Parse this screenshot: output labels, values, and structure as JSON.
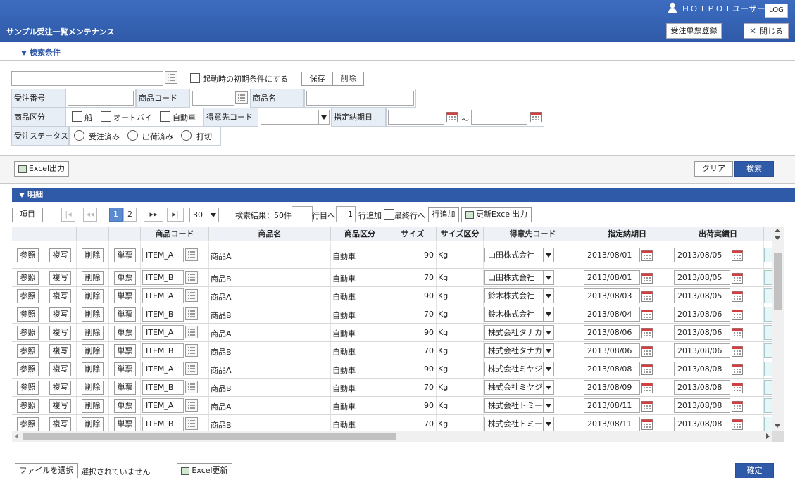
{
  "header": {
    "page_title": "サンプル受注一覧メンテナンス",
    "user_name": "ＨＯＩＰＯＩユーザー",
    "log_label": "LOG",
    "order_register_label": "受注単票登録",
    "close_label": "閉じる"
  },
  "search": {
    "section_label": "検索条件",
    "preset_value": "",
    "init_condition_label": "起動時の初期条件にする",
    "save_label": "保存",
    "delete_label": "削除",
    "order_no_label": "受注番号",
    "product_code_label": "商品コード",
    "product_name_label": "商品名",
    "category_label": "商品区分",
    "category_options": [
      "船",
      "オートバイ",
      "自動車"
    ],
    "customer_code_label": "得意先コード",
    "due_date_label": "指定納期日",
    "tilde": "～",
    "status_label": "受注ステータス",
    "status_options": [
      "受注済み",
      "出荷済み",
      "打切"
    ],
    "excel_out_label": "Excel出力",
    "clear_label": "クリア",
    "search_label": "検索"
  },
  "detail": {
    "section_label": "明細",
    "columns_btn": "項目",
    "pages": [
      "1",
      "2"
    ],
    "page_size": "30",
    "result_text": "検索結果：50件",
    "goto_row_label": "行目へ",
    "add_row_count": "1",
    "add_row_label": "行追加",
    "last_row_label": "最終行へ",
    "row_add_btn": "行追加",
    "update_excel_label": "更新Excel出力",
    "headers": [
      "",
      "",
      "",
      "",
      "商品コード",
      "商品名",
      "商品区分",
      "サイズ",
      "サイズ区分",
      "得意先コード",
      "指定納期日",
      "出荷実績日"
    ],
    "row_buttons": [
      "参照",
      "複写",
      "削除",
      "単票"
    ],
    "rows": [
      {
        "code": "ITEM_A",
        "name": "商品A",
        "category": "自動車",
        "size": "90",
        "unit": "Kg",
        "customer": "山田株式会社",
        "due": "2013/08/01",
        "ship": "2013/08/05"
      },
      {
        "code": "ITEM_B",
        "name": "商品B",
        "category": "自動車",
        "size": "70",
        "unit": "Kg",
        "customer": "山田株式会社",
        "due": "2013/08/01",
        "ship": "2013/08/05"
      },
      {
        "code": "ITEM_A",
        "name": "商品A",
        "category": "自動車",
        "size": "90",
        "unit": "Kg",
        "customer": "鈴木株式会社",
        "due": "2013/08/03",
        "ship": "2013/08/05"
      },
      {
        "code": "ITEM_B",
        "name": "商品B",
        "category": "自動車",
        "size": "70",
        "unit": "Kg",
        "customer": "鈴木株式会社",
        "due": "2013/08/04",
        "ship": "2013/08/06"
      },
      {
        "code": "ITEM_A",
        "name": "商品A",
        "category": "自動車",
        "size": "90",
        "unit": "Kg",
        "customer": "株式会社タナカ",
        "due": "2013/08/06",
        "ship": "2013/08/06"
      },
      {
        "code": "ITEM_B",
        "name": "商品B",
        "category": "自動車",
        "size": "70",
        "unit": "Kg",
        "customer": "株式会社タナカ",
        "due": "2013/08/06",
        "ship": "2013/08/06"
      },
      {
        "code": "ITEM_A",
        "name": "商品A",
        "category": "自動車",
        "size": "90",
        "unit": "Kg",
        "customer": "株式会社ミヤジ",
        "due": "2013/08/08",
        "ship": "2013/08/08"
      },
      {
        "code": "ITEM_B",
        "name": "商品B",
        "category": "自動車",
        "size": "70",
        "unit": "Kg",
        "customer": "株式会社ミヤジ",
        "due": "2013/08/09",
        "ship": "2013/08/08"
      },
      {
        "code": "ITEM_A",
        "name": "商品A",
        "category": "自動車",
        "size": "90",
        "unit": "Kg",
        "customer": "株式会社トミー",
        "due": "2013/08/11",
        "ship": "2013/08/08"
      },
      {
        "code": "ITEM_B",
        "name": "商品B",
        "category": "自動車",
        "size": "70",
        "unit": "Kg",
        "customer": "株式会社トミー",
        "due": "2013/08/11",
        "ship": "2013/08/08"
      }
    ]
  },
  "footer": {
    "file_select_label": "ファイルを選択",
    "no_file_label": "選択されていません",
    "excel_update_label": "Excel更新",
    "confirm_label": "確定"
  }
}
